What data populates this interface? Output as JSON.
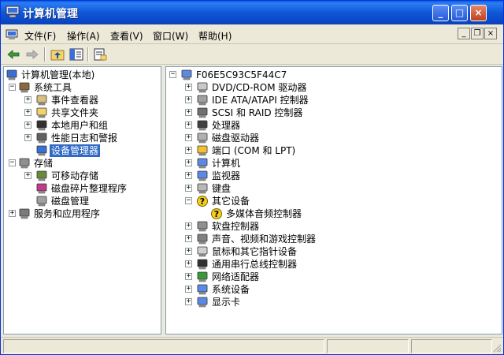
{
  "window": {
    "title": "计算机管理",
    "icon": "computer-management-icon",
    "controls": {
      "minimize": "_",
      "maximize": "□",
      "close": "×"
    }
  },
  "menu": {
    "items": [
      "文件(F)",
      "操作(A)",
      "查看(V)",
      "窗口(W)",
      "帮助(H)"
    ],
    "mdi_controls": {
      "minimize": "_",
      "restore": "❐",
      "close": "×"
    }
  },
  "toolbar": {
    "buttons": [
      "back-arrow-icon",
      "forward-arrow-icon",
      "up-folder-icon",
      "show-hide-tree-icon",
      "properties-icon"
    ]
  },
  "left_tree": [
    {
      "label": "计算机管理(本地)",
      "icon": "computer-management-icon",
      "expander": ""
    },
    {
      "label": "系统工具",
      "icon": "system-tools-icon",
      "expander": "−"
    },
    {
      "label": "事件查看器",
      "icon": "event-viewer-icon",
      "expander": "+"
    },
    {
      "label": "共享文件夹",
      "icon": "shared-folder-icon",
      "expander": "+"
    },
    {
      "label": "本地用户和组",
      "icon": "users-icon",
      "expander": "+"
    },
    {
      "label": "性能日志和警报",
      "icon": "performance-icon",
      "expander": "+"
    },
    {
      "label": "设备管理器",
      "icon": "device-manager-icon",
      "expander": "",
      "selected": true
    },
    {
      "label": "存储",
      "icon": "storage-icon",
      "expander": "−"
    },
    {
      "label": "可移动存储",
      "icon": "removable-storage-icon",
      "expander": "+"
    },
    {
      "label": "磁盘碎片整理程序",
      "icon": "defrag-icon",
      "expander": ""
    },
    {
      "label": "磁盘管理",
      "icon": "disk-management-icon",
      "expander": ""
    },
    {
      "label": "服务和应用程序",
      "icon": "services-icon",
      "expander": "+"
    }
  ],
  "right_tree": [
    {
      "label": "F06E5C93C5F44C7",
      "icon": "computer-icon",
      "expander": "−"
    },
    {
      "label": "DVD/CD-ROM 驱动器",
      "icon": "cdrom-icon",
      "expander": "+"
    },
    {
      "label": "IDE ATA/ATAPI 控制器",
      "icon": "ide-controller-icon",
      "expander": "+"
    },
    {
      "label": "SCSI 和 RAID 控制器",
      "icon": "scsi-icon",
      "expander": "+"
    },
    {
      "label": "处理器",
      "icon": "processor-icon",
      "expander": "+"
    },
    {
      "label": "磁盘驱动器",
      "icon": "disk-drive-icon",
      "expander": "+"
    },
    {
      "label": "端口 (COM 和 LPT)",
      "icon": "port-icon",
      "expander": "+"
    },
    {
      "label": "计算机",
      "icon": "computer-icon",
      "expander": "+"
    },
    {
      "label": "监视器",
      "icon": "monitor-icon",
      "expander": "+"
    },
    {
      "label": "键盘",
      "icon": "keyboard-icon",
      "expander": "+"
    },
    {
      "label": "其它设备",
      "icon": "unknown-device-icon",
      "expander": "−"
    },
    {
      "label": "多媒体音频控制器",
      "icon": "warning-device-icon",
      "expander": ""
    },
    {
      "label": "软盘控制器",
      "icon": "floppy-controller-icon",
      "expander": "+"
    },
    {
      "label": "声音、视频和游戏控制器",
      "icon": "sound-icon",
      "expander": "+"
    },
    {
      "label": "鼠标和其它指针设备",
      "icon": "mouse-icon",
      "expander": "+"
    },
    {
      "label": "通用串行总线控制器",
      "icon": "usb-icon",
      "expander": "+"
    },
    {
      "label": "网络适配器",
      "icon": "network-adapter-icon",
      "expander": "+"
    },
    {
      "label": "系统设备",
      "icon": "system-device-icon",
      "expander": "+"
    },
    {
      "label": "显示卡",
      "icon": "display-adapter-icon",
      "expander": "+"
    }
  ],
  "colors": {
    "titlebar": "#0A49C8",
    "selection": "#316AC5",
    "window_bg": "#ECE9D8"
  }
}
